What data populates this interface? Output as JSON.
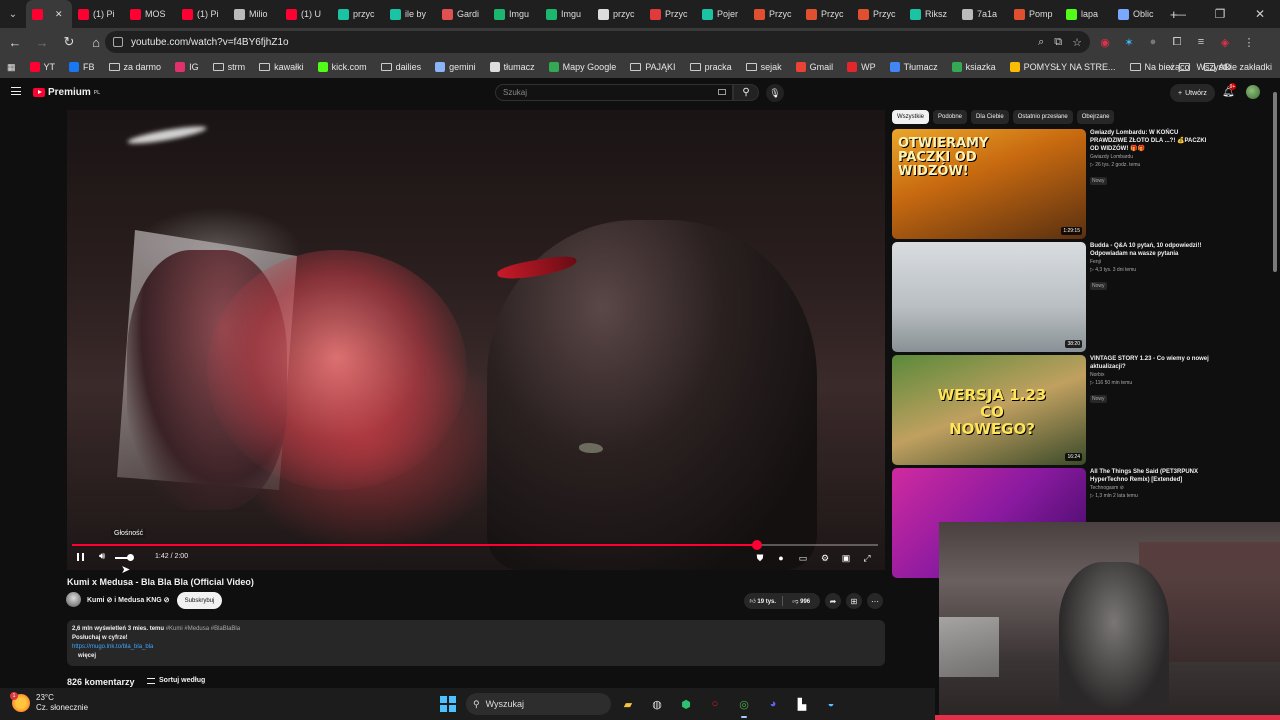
{
  "browser": {
    "tabs": [
      {
        "label": "",
        "color": "#ff0033",
        "active": true
      },
      {
        "label": "(1) Pi",
        "color": "#ff0033"
      },
      {
        "label": "MOS",
        "color": "#ff0033"
      },
      {
        "label": "(1) Pi",
        "color": "#ff0033"
      },
      {
        "label": "Milio",
        "color": "#bbbbbb"
      },
      {
        "label": "(1) U",
        "color": "#ff0033"
      },
      {
        "label": "przyc",
        "color": "#19c3a3"
      },
      {
        "label": "ile by",
        "color": "#19c3a3"
      },
      {
        "label": "Gardi",
        "color": "#e05050"
      },
      {
        "label": "Imgu",
        "color": "#1bb76e"
      },
      {
        "label": "Imgu",
        "color": "#1bb76e"
      },
      {
        "label": "przyc",
        "color": "#dddddd"
      },
      {
        "label": "Przyc",
        "color": "#e03a3a"
      },
      {
        "label": "Pojer",
        "color": "#19c3a3"
      },
      {
        "label": "Przyc",
        "color": "#e05030"
      },
      {
        "label": "Przyc",
        "color": "#e05030"
      },
      {
        "label": "Przyc",
        "color": "#e05030"
      },
      {
        "label": "Riksz",
        "color": "#19c3a3"
      },
      {
        "label": "7a1a",
        "color": "#bbbbbb"
      },
      {
        "label": "Pomp",
        "color": "#e05030"
      },
      {
        "label": "lapa",
        "color": "#53fc18"
      },
      {
        "label": "Oblic",
        "color": "#7aa7ff"
      }
    ],
    "new_tab": "+",
    "window_controls": {
      "minimize": "—",
      "restore": "❐",
      "close": "✕"
    },
    "url": "youtube.com/watch?v=f4BY6fjhZ1o",
    "bookmarks": [
      {
        "label": "YT",
        "type": "fav",
        "color": "#ff0033"
      },
      {
        "label": "FB",
        "type": "fav",
        "color": "#1877f2"
      },
      {
        "label": "za darmo",
        "type": "folder"
      },
      {
        "label": "IG",
        "type": "fav",
        "color": "#e1306c"
      },
      {
        "label": "strm",
        "type": "folder"
      },
      {
        "label": "kawałki",
        "type": "folder"
      },
      {
        "label": "kick.com",
        "type": "fav",
        "color": "#53fc18"
      },
      {
        "label": "dailies",
        "type": "folder"
      },
      {
        "label": "gemini",
        "type": "fav",
        "color": "#8ab4f8"
      },
      {
        "label": "tłumacz",
        "type": "fav",
        "color": "#dddddd"
      },
      {
        "label": "Mapy Google",
        "type": "fav",
        "color": "#34a853"
      },
      {
        "label": "PAJĄKI",
        "type": "folder"
      },
      {
        "label": "pracka",
        "type": "folder"
      },
      {
        "label": "sejak",
        "type": "folder"
      },
      {
        "label": "Gmail",
        "type": "fav",
        "color": "#ea4335"
      },
      {
        "label": "WP",
        "type": "fav",
        "color": "#e3262c"
      },
      {
        "label": "Tłumacz",
        "type": "fav",
        "color": "#4285f4"
      },
      {
        "label": "ksiazka",
        "type": "fav",
        "color": "#34a853"
      },
      {
        "label": "POMYSŁY NA STRE...",
        "type": "fav",
        "color": "#fbbc04"
      },
      {
        "label": "Na bieżąco",
        "type": "folder"
      },
      {
        "label": "AD",
        "type": "folder"
      }
    ],
    "more_bookmarks": "»",
    "all_bookmarks": "Wszystkie zakładki"
  },
  "youtube": {
    "logo_text": "Premium",
    "logo_sup": "PL",
    "search_placeholder": "Szukaj",
    "create_label": "Utwórz",
    "notifications_count": "9+",
    "player": {
      "tooltip": "Głośność",
      "time": "1:42 / 2:00",
      "progress": 0.85,
      "volume": 0.75
    },
    "video_title": "Kumi x Medusa - Bla Bla Bla (Official Video)",
    "channel": "Kumi ⊘ i Medusa KNG ⊘",
    "subscribe_label": "Subskrybuj",
    "likes": "19 tys.",
    "dislikes": "996",
    "description": {
      "views_date": "2,6 mln wyświetleń  3 mies. temu",
      "tags": "#Kumi #Medusa #BlaBlaBla",
      "line1": "Posłuchaj w cyfrze!",
      "link": "https://mugo.lnk.to/bla_bla_bla",
      "more": "więcej"
    },
    "comments_count": "826 komentarzy",
    "sort_label": "Sortuj według",
    "chips": [
      {
        "label": "Wszystkie",
        "active": true
      },
      {
        "label": "Podobne"
      },
      {
        "label": "Dla Ciebie"
      },
      {
        "label": "Ostatnio przesłane"
      },
      {
        "label": "Obejrzane"
      }
    ],
    "recommendations": [
      {
        "title": "Gwiazdy Lombardu: W KOŃCU PRAWDZIWE ZŁOTO DLA ...?! 💰PACZKI OD WIDZÓW! 🎁🎁",
        "channel": "Gwiazdy Lombardu",
        "meta": "▷ 26 tys.  2 godz. temu",
        "badge": "Nowy",
        "duration": "1:29:15",
        "thumb_text": "OTWIERAMY PACZKI OD WIDZÓW!"
      },
      {
        "title": "Budda - Q&A 10 pytań, 10 odpowiedzi!! Odpowiadam na wasze pytania",
        "channel": "Fenji",
        "meta": "▷ 4,3 tys.  3 dni temu",
        "badge": "Nowy",
        "duration": "38:20",
        "thumb_text": ""
      },
      {
        "title": "VINTAGE STORY 1.23 - Co wiemy o nowej aktualizacji?",
        "channel": "Norbix",
        "meta": "▷ 116  50 min temu",
        "badge": "Nowy",
        "duration": "16:24",
        "thumb_text": "WERSJA 1.23 CO NOWEGO?"
      },
      {
        "title": "All The Things She Said (PET3RPUNX HyperTechno Remix) [Extended]",
        "channel": "Technogasm ⊘",
        "meta": "▷ 1,3 mln  2 lata temu",
        "badge": "",
        "duration": "",
        "thumb_text": ""
      }
    ]
  },
  "taskbar": {
    "temperature": "23°C",
    "weather": "Cz. słonecznie",
    "weather_badge": "1",
    "search_label": "Wyszukaj"
  }
}
